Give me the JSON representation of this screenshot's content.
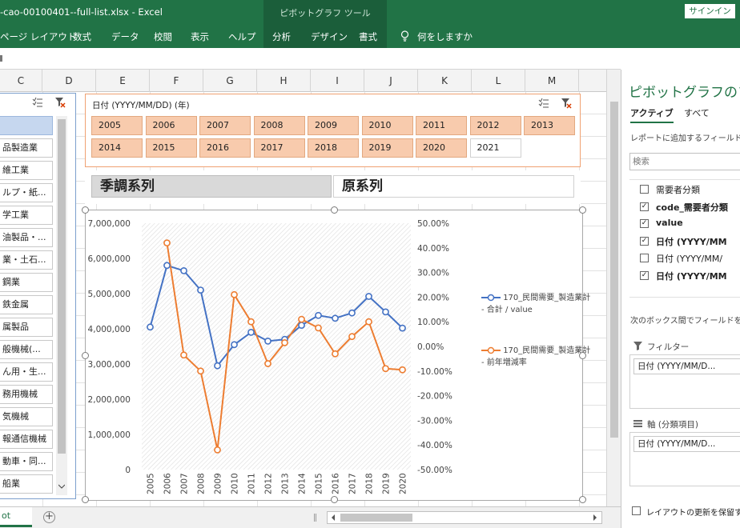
{
  "titlebar": {
    "document": "-cao-00100401--full-list.xlsx  -  Excel",
    "context_tab": "ピボットグラフ ツール",
    "signin": "サインイン"
  },
  "ribbon": {
    "tabs": [
      "ページ レイアウト",
      "数式",
      "データ",
      "校閲",
      "表示",
      "ヘルプ",
      "分析",
      "デザイン",
      "書式"
    ],
    "tellme": "何をしますか"
  },
  "column_headers": [
    "C",
    "D",
    "E",
    "F",
    "G",
    "H",
    "I",
    "J",
    "K",
    "L",
    "M"
  ],
  "slicer_left": {
    "items": [
      "",
      "品製造業",
      "維工業",
      "ルプ・紙...",
      "学工業",
      "油製品・...",
      "業・土石...",
      "鋼業",
      "鉄金属",
      "属製品",
      "般機械(...",
      "ん用・生...",
      "務用機械",
      "気機械",
      "報通信機械",
      "動車・同...",
      "船業"
    ]
  },
  "slicer_top": {
    "header": "日付 (YYYY/MM/DD) (年)",
    "items": [
      "2005",
      "2006",
      "2007",
      "2008",
      "2009",
      "2010",
      "2011",
      "2012",
      "2013",
      "2014",
      "2015",
      "2016",
      "2017",
      "2018",
      "2019",
      "2020",
      "2021"
    ]
  },
  "buttons": {
    "seasonal": "季調系列",
    "original": "原系列"
  },
  "chart_data": {
    "type": "line",
    "categories": [
      "2005",
      "2006",
      "2007",
      "2008",
      "2009",
      "2010",
      "2011",
      "2012",
      "2013",
      "2014",
      "2015",
      "2016",
      "2017",
      "2018",
      "2019",
      "2020"
    ],
    "series": [
      {
        "name": "170_民間需要_製造業計 - 合計 / value",
        "axis": "left",
        "color": "#4472c4",
        "values": [
          4050000,
          5800000,
          5650000,
          5100000,
          2950000,
          3550000,
          3900000,
          3650000,
          3700000,
          4100000,
          4380000,
          4300000,
          4450000,
          4920000,
          4480000,
          4020000
        ]
      },
      {
        "name": "170_民間需要_製造業計 - 前年増減率",
        "axis": "right",
        "color": "#ed7d31",
        "values": [
          null,
          0.42,
          -0.035,
          -0.1,
          -0.42,
          0.21,
          0.1,
          -0.07,
          0.015,
          0.11,
          0.075,
          -0.03,
          0.04,
          0.1,
          -0.09,
          -0.095
        ]
      }
    ],
    "y_left": {
      "ticks": [
        "7,000,000",
        "6,000,000",
        "5,000,000",
        "4,000,000",
        "3,000,000",
        "2,000,000",
        "1,000,000",
        "0"
      ],
      "ylim": [
        0,
        7000000
      ]
    },
    "y_right": {
      "ticks": [
        "50.00%",
        "40.00%",
        "30.00%",
        "20.00%",
        "10.00%",
        "0.00%",
        "-10.00%",
        "-20.00%",
        "-30.00%",
        "-40.00%",
        "-50.00%"
      ],
      "ylim": [
        -0.5,
        0.5
      ]
    },
    "legend": {
      "position": "right",
      "entries": [
        {
          "line1": "170_民間需要_製造業計",
          "line2": "- 合計 / value"
        },
        {
          "line1": "170_民間需要_製造業計",
          "line2": "- 前年増減率"
        }
      ]
    }
  },
  "sheet": {
    "tab": "ot",
    "add": "+"
  },
  "pane": {
    "title": "ピボットグラフのフィ",
    "tab_active": "アクティブ",
    "tab_all": "すべて",
    "desc": "レポートに追加するフィールドを選",
    "search_placeholder": "検索",
    "fields": [
      {
        "label": "需要者分類",
        "checked": false,
        "bold": false
      },
      {
        "label": "code_需要者分類",
        "checked": true,
        "bold": true
      },
      {
        "label": "value",
        "checked": true,
        "bold": true
      },
      {
        "label": "日付 (YYYY/MM",
        "checked": true,
        "bold": true
      },
      {
        "label": "日付 (YYYY/MM/",
        "checked": false,
        "bold": false
      },
      {
        "label": "日付 (YYYY/MM",
        "checked": true,
        "bold": true
      }
    ],
    "hint": "次のボックス間でフィールドをドラ",
    "filter_label": "フィルター",
    "filter_item": "日付 (YYYY/MM/D...",
    "axis_label": "軸 (分類項目)",
    "axis_item": "日付 (YYYY/MM/D...",
    "defer": "レイアウトの更新を保留する"
  }
}
